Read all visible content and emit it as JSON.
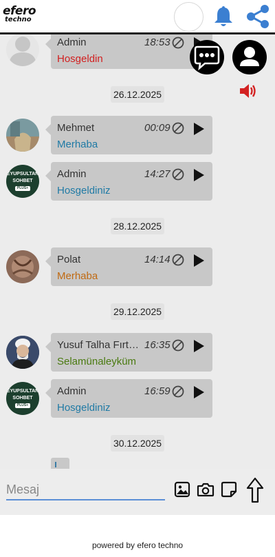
{
  "header": {
    "logo_line1": "efero",
    "logo_line2": "techno"
  },
  "messages": [
    {
      "sender": "Admin",
      "time": "18:53",
      "text": "Hosgeldin",
      "text_color": "#d21f1f",
      "avatar": "default-avatar"
    },
    {
      "sender": "Mehmet",
      "time": "00:09",
      "text": "Merhaba",
      "text_color": "#1f7aa5",
      "avatar": "photo-avatar"
    },
    {
      "sender": "Admin",
      "time": "14:27",
      "text": "Hosgeldiniz",
      "text_color": "#1f7aa5",
      "avatar": "brand-avatar"
    },
    {
      "sender": "Polat",
      "time": "14:14",
      "text": "Merhaba",
      "text_color": "#c06a12",
      "avatar": "photo-avatar"
    },
    {
      "sender": "Yusuf Talha Fırtına",
      "time": "16:35",
      "text": "Selamünaleyküm",
      "text_color": "#4a7a10",
      "avatar": "photo-avatar"
    },
    {
      "sender": "Admin",
      "time": "16:59",
      "text": "Hosgeldiniz",
      "text_color": "#1f7aa5",
      "avatar": "brand-avatar"
    }
  ],
  "dates": [
    "26.12.2025",
    "28.12.2025",
    "29.12.2025",
    "30.12.2025"
  ],
  "brand_avatar": {
    "line1": "EYUPSULTAN",
    "line2": "SOHBET",
    "line3": "PLUS+"
  },
  "input": {
    "placeholder": "Mesaj"
  },
  "footer": {
    "powered": "powered by efero techno"
  },
  "colors": {
    "accent_blue": "#1f7aa5",
    "bell": "#3b7fd1",
    "speaker": "#d32222",
    "bubble": "#c8c8c8"
  }
}
